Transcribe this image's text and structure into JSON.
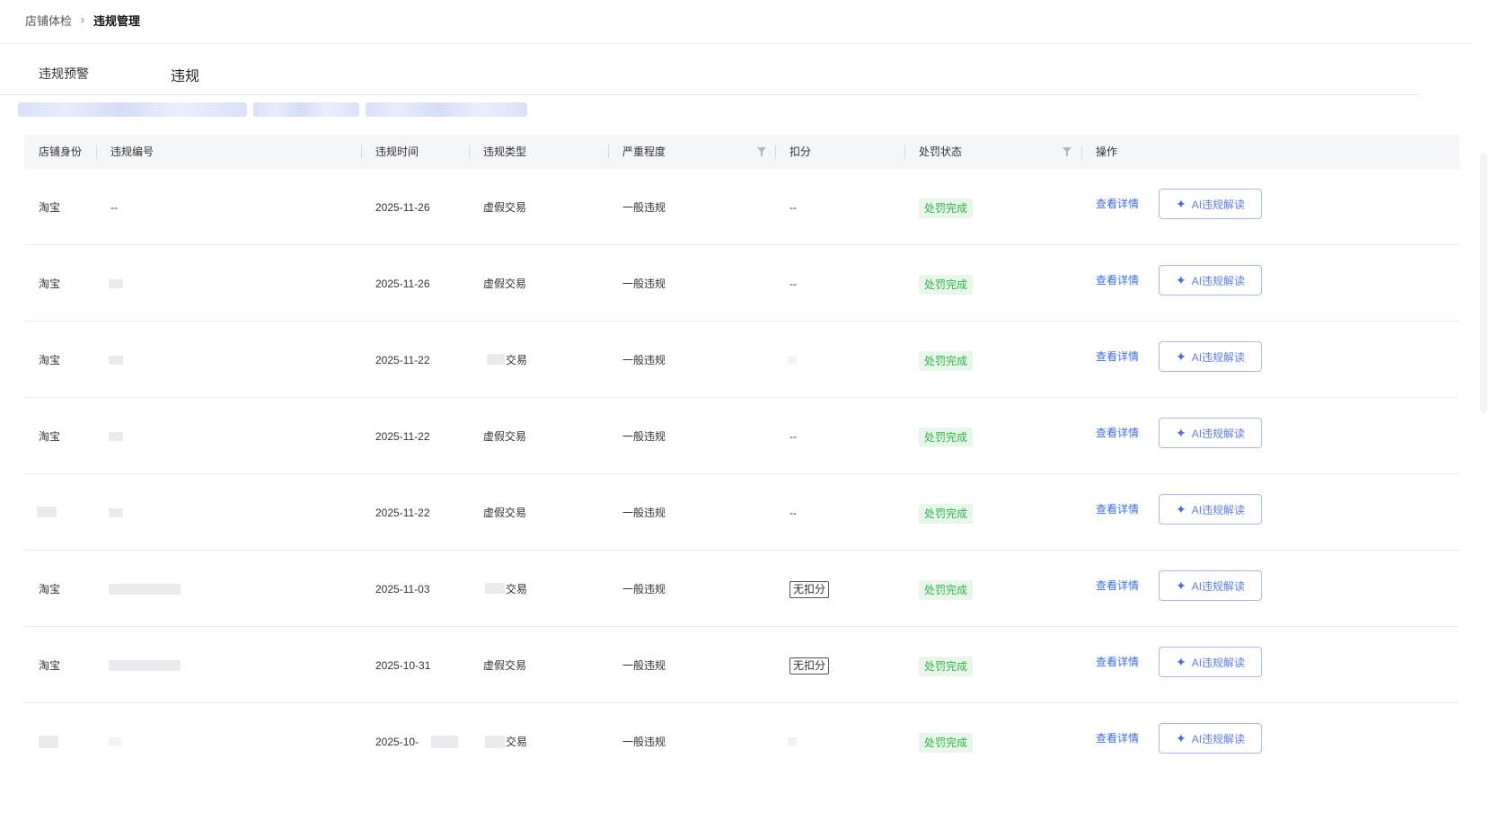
{
  "breadcrumb": {
    "parent": "店铺体检",
    "separator": "›",
    "current": "违规管理"
  },
  "tabs": {
    "warning": "违规预警",
    "violation": "违规"
  },
  "table": {
    "headers": {
      "identity": "店铺身份",
      "number": "违规编号",
      "time": "违规时间",
      "type": "违规类型",
      "severity": "严重程度",
      "score": "扣分",
      "status": "处罚状态",
      "action": "操作"
    },
    "action_detail_label": "查看详情",
    "action_ai_label": "AI违规解读",
    "rows": [
      {
        "identity": "淘宝",
        "number": "--",
        "time": "2025-11-26",
        "type": "虚假交易",
        "severity": "一般违规",
        "score": "--",
        "status": "处罚完成"
      },
      {
        "identity": "淘宝",
        "number": "",
        "time": "2025-11-26",
        "type": "虚假交易",
        "severity": "一般违规",
        "score": "--",
        "status": "处罚完成"
      },
      {
        "identity": "淘宝",
        "number": "",
        "time": "2025-11-22",
        "type": "交易",
        "severity": "一般违规",
        "score": "",
        "status": "处罚完成"
      },
      {
        "identity": "淘宝",
        "number": "",
        "time": "2025-11-22",
        "type": "虚假交易",
        "severity": "一般违规",
        "score": "--",
        "status": "处罚完成"
      },
      {
        "identity": "",
        "number": "",
        "time": "2025-11-22",
        "type": "虚假交易",
        "severity": "一般违规",
        "score": "--",
        "status": "处罚完成"
      },
      {
        "identity": "淘宝",
        "number": "",
        "time": "2025-11-03",
        "type": "交易",
        "severity": "一般违规",
        "score": "无扣分",
        "status": "处罚完成"
      },
      {
        "identity": "淘宝",
        "number": "",
        "time": "2025-10-31",
        "type": "虚假交易",
        "severity": "一般违规",
        "score": "无扣分",
        "status": "处罚完成"
      },
      {
        "identity": "",
        "number": "",
        "time": "2025-10-",
        "type": "交易",
        "severity": "一般违规",
        "score": "",
        "status": "处罚完成"
      }
    ]
  },
  "colors": {
    "link": "#3b6ee6",
    "status_bg": "#e8f7ea",
    "status_text": "#2fb34a",
    "ai_border": "#a9b8f6"
  },
  "icons": {
    "breadcrumb_sep": "chevron-right-icon",
    "filter": "filter-icon",
    "ai": "sparkle-icon"
  }
}
